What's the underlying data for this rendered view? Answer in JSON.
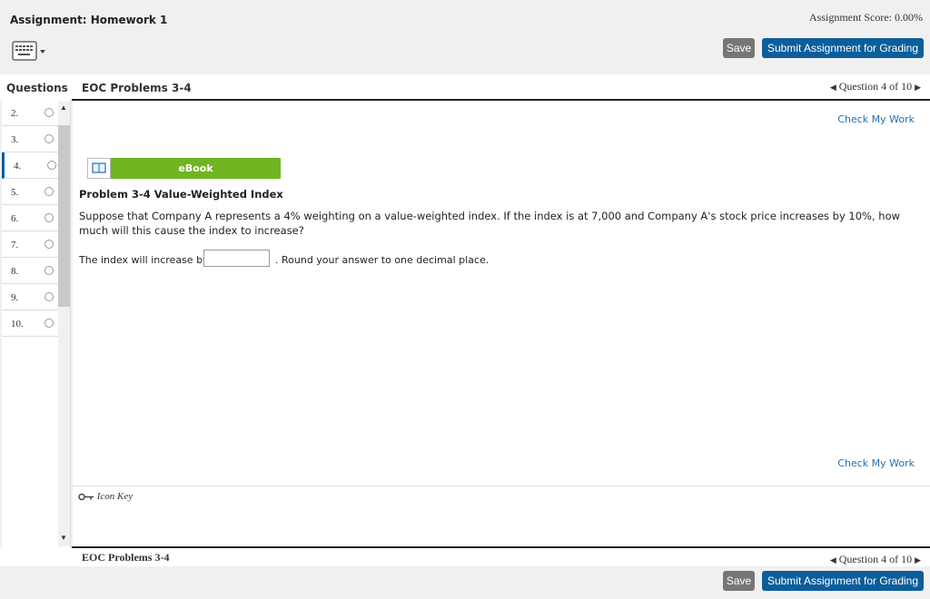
{
  "header": {
    "assignment_title": "Assignment: Homework 1",
    "score": "Assignment Score: 0.00%",
    "save_label": "Save",
    "submit_label": "Submit Assignment for Grading"
  },
  "questions_panel": {
    "label": "Questions",
    "items": [
      {
        "num": "2."
      },
      {
        "num": "3."
      },
      {
        "num": "4."
      },
      {
        "num": "5."
      },
      {
        "num": "6."
      },
      {
        "num": "7."
      },
      {
        "num": "8."
      },
      {
        "num": "9."
      },
      {
        "num": "10."
      }
    ]
  },
  "section_title": "EOC Problems 3-4",
  "nav": {
    "question_label": "Question 4 of 10"
  },
  "main": {
    "check_my_work": "Check My Work",
    "ebook_label": "eBook",
    "problem_title": "Problem 3-4 Value-Weighted Index",
    "problem_text": "Suppose that Company A represents a 4% weighting on a value-weighted index. If the index is at 7,000 and Company A's stock price increases by 10%, how much will this cause the index to increase?",
    "answer_prefix": "The index will increase by",
    "answer_value": "",
    "answer_suffix": ". Round your answer to one decimal place.",
    "icon_key": "Icon Key"
  },
  "colors": {
    "accent": "#0b5e9a",
    "ebook_green": "#6fb51f",
    "link": "#1f6fb2"
  }
}
